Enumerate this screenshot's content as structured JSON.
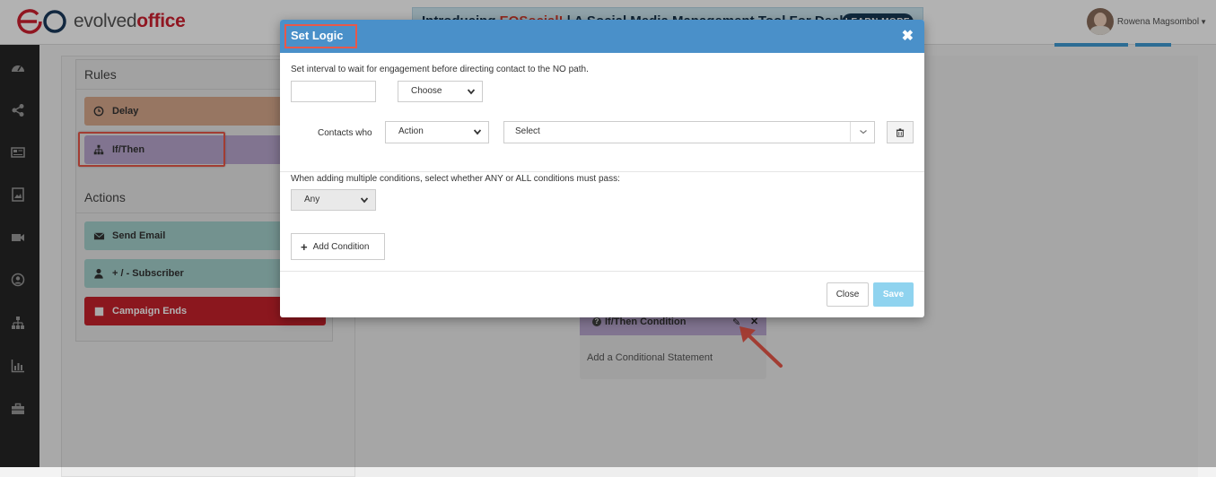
{
  "header": {
    "logo_text_a": "evolved",
    "logo_text_b": "office",
    "banner_text_a": "Introducing ",
    "banner_text_hl": "EOSocial!",
    "banner_text_b": "  |  A Social Media Management Tool For Dealers",
    "banner_button": "LEARN MORE",
    "user_name": "Rowena Magsombol"
  },
  "leftnav": {
    "icons": [
      "dashboard-icon",
      "share-icon",
      "newspaper-icon",
      "image-icon",
      "video-icon",
      "user-circle-icon",
      "sitemap-icon",
      "bar-chart-icon",
      "briefcase-icon"
    ]
  },
  "rules_panel": {
    "rules_heading": "Rules",
    "delay_label": "Delay",
    "ifthen_label": "If/Then",
    "actions_heading": "Actions",
    "send_email_label": "Send Email",
    "subscriber_label": "+ / - Subscriber",
    "campaign_ends_label": "Campaign Ends"
  },
  "condition_card": {
    "title": "If/Then Condition",
    "body": "Add a Conditional Statement"
  },
  "modal": {
    "title": "Set Logic",
    "close_glyph": "✖",
    "interval_label": "Set interval to wait for engagement before directing contact to the NO path.",
    "interval_value": "",
    "interval_unit_select": "Choose",
    "contacts_who_label": "Contacts who",
    "action_select": "Action",
    "value_select": "Select",
    "multi_label": "When adding multiple conditions, select whether ANY or ALL conditions must pass:",
    "any_all_select": "Any",
    "add_condition_label": "Add Condition",
    "close_button": "Close",
    "save_button": "Save"
  },
  "colors": {
    "modal_header": "#4a90c9",
    "delay": "#d9a98d",
    "ifthen": "#b9a6ce",
    "action": "#a5d2cd",
    "campaign_end": "#c8212b",
    "highlight": "#e8584a",
    "save": "#8fd3ef"
  }
}
